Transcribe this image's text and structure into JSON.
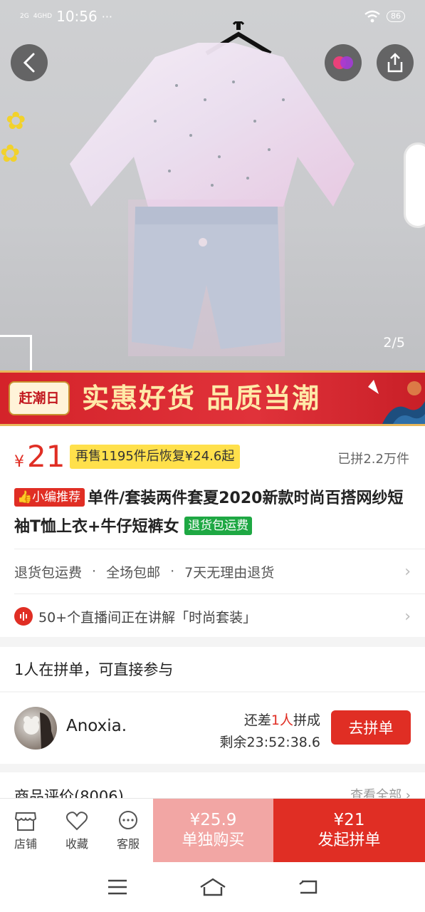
{
  "status": {
    "signal1": "2G",
    "signal2": "4GHD",
    "time": "10:56",
    "more": "···",
    "battery": "86"
  },
  "image": {
    "counter": "2/5"
  },
  "banner": {
    "tag": "赶潮日",
    "slogan": "实惠好货 品质当潮"
  },
  "product": {
    "currency": "¥",
    "price": "21",
    "restore_note": "再售1195件后恢复¥24.6起",
    "sold": "已拼2.2万件",
    "rec_badge": "小编推荐",
    "title": "单件/套装两件套夏2020新款时尚百搭网纱短袖T恤上衣+牛仔短裤女",
    "return_badge": "退货包运费"
  },
  "services": {
    "item1": "退货包运费",
    "item2": "全场包邮",
    "item3": "7天无理由退货",
    "sep": "·"
  },
  "live": {
    "text": "50+个直播间正在讲解「时尚套装」"
  },
  "group": {
    "heading": "1人在拼单，可直接参与",
    "user": "Anoxia.",
    "need_prefix": "还差",
    "need_count": "1人",
    "need_suffix": "拼成",
    "remain": "剩余23:52:38.6",
    "join": "去拼单"
  },
  "reviews": {
    "title": "商品评价(8006)",
    "all": "查看全部"
  },
  "bottom": {
    "shop": "店铺",
    "fav": "收藏",
    "service": "客服",
    "alone_price": "¥25.9",
    "alone_label": "单独购买",
    "group_price": "¥21",
    "group_label": "发起拼单"
  },
  "colors": {
    "accent": "#e02e24",
    "alone_bg": "#f2a6a4",
    "restore_bg": "#ffe04b",
    "green": "#1ea843"
  }
}
